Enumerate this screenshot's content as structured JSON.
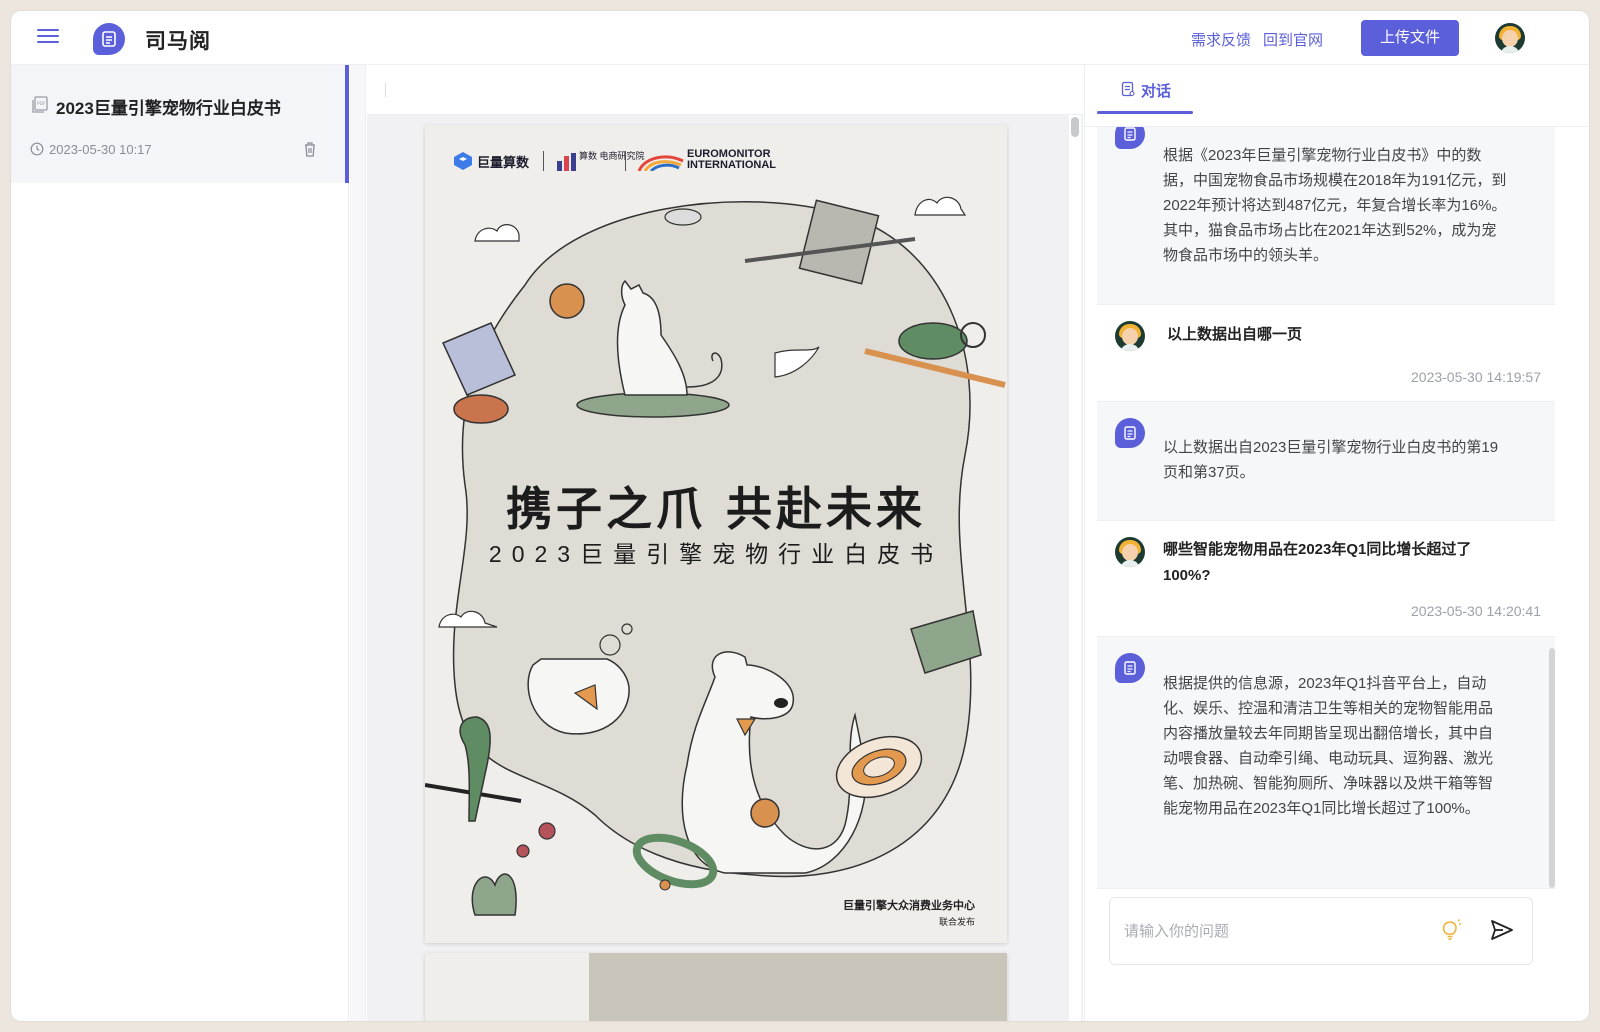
{
  "app": {
    "name": "司马阅"
  },
  "header": {
    "feedback_link": "需求反馈",
    "home_link": "回到官网",
    "upload_button": "上传文件"
  },
  "sidebar": {
    "documents": [
      {
        "title": "2023巨量引擎宠物行业白皮书",
        "time": "2023-05-30 10:17"
      }
    ]
  },
  "document": {
    "cover": {
      "logos": [
        "巨量算数",
        "算数 电商研究院",
        "EUROMONITOR",
        "INTERNATIONAL"
      ],
      "title": "携子之爪 共赴未来",
      "subtitle": "2023巨量引擎宠物行业白皮书",
      "footer_line1": "巨量引擎大众消费业务中心",
      "footer_line2": "联合发布"
    }
  },
  "chat": {
    "tab_label": "对话",
    "messages": [
      {
        "role": "bot",
        "text": "根据《2023年巨量引擎宠物行业白皮书》中的数据，中国宠物食品市场规模在2018年为191亿元，到2022年预计将达到487亿元，年复合增长率为16%。其中，猫食品市场占比在2021年达到52%，成为宠物食品市场中的领头羊。"
      },
      {
        "role": "user",
        "text": "以上数据出自哪一页",
        "time": "2023-05-30 14:19:57"
      },
      {
        "role": "bot",
        "text": "以上数据出自2023巨量引擎宠物行业白皮书的第19页和第37页。"
      },
      {
        "role": "user",
        "text": "哪些智能宠物用品在2023年Q1同比增长超过了100%?",
        "time": "2023-05-30 14:20:41"
      },
      {
        "role": "bot",
        "text": "根据提供的信息源，2023年Q1抖音平台上，自动化、娱乐、控温和清洁卫生等相关的宠物智能用品内容播放量较去年同期皆呈现出翻倍增长，其中自动喂食器、自动牵引绳、电动玩具、逗狗器、激光笔、加热碗、智能狗厕所、净味器以及烘干箱等智能宠物用品在2023年Q1同比增长超过了100%。"
      }
    ],
    "input_placeholder": "请输入你的问题"
  },
  "colors": {
    "accent": "#5b5fd9"
  }
}
